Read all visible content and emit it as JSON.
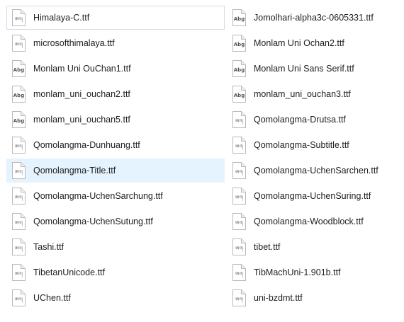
{
  "files": {
    "left": [
      {
        "name": "Himalaya-C.ttf",
        "icon": "tibetan-font-icon"
      },
      {
        "name": "microsofthimalaya.ttf",
        "icon": "tibetan-font-icon"
      },
      {
        "name": "Monlam Uni OuChan1.ttf",
        "icon": "abg-font-icon"
      },
      {
        "name": "monlam_uni_ouchan2.ttf",
        "icon": "abg-font-icon"
      },
      {
        "name": "monlam_uni_ouchan5.ttf",
        "icon": "abg-font-icon"
      },
      {
        "name": "Qomolangma-Dunhuang.ttf",
        "icon": "tibetan-font-icon"
      },
      {
        "name": "Qomolangma-Title.ttf",
        "icon": "tibetan-font-icon"
      },
      {
        "name": "Qomolangma-UchenSarchung.ttf",
        "icon": "tibetan-font-icon"
      },
      {
        "name": "Qomolangma-UchenSutung.ttf",
        "icon": "tibetan-font-icon"
      },
      {
        "name": "Tashi.ttf",
        "icon": "tibetan-font-icon"
      },
      {
        "name": "TibetanUnicode.ttf",
        "icon": "tibetan-font-icon"
      },
      {
        "name": "UChen.ttf",
        "icon": "tibetan-font-icon"
      }
    ],
    "right": [
      {
        "name": "Jomolhari-alpha3c-0605331.ttf",
        "icon": "abg-font-icon"
      },
      {
        "name": "Monlam Uni Ochan2.ttf",
        "icon": "abg-font-icon"
      },
      {
        "name": "Monlam Uni Sans Serif.ttf",
        "icon": "abg-font-icon"
      },
      {
        "name": "monlam_uni_ouchan3.ttf",
        "icon": "abg-font-icon"
      },
      {
        "name": "Qomolangma-Drutsa.ttf",
        "icon": "tibetan-font-icon"
      },
      {
        "name": "Qomolangma-Subtitle.ttf",
        "icon": "tibetan-font-icon"
      },
      {
        "name": "Qomolangma-UchenSarchen.ttf",
        "icon": "tibetan-font-icon"
      },
      {
        "name": "Qomolangma-UchenSuring.ttf",
        "icon": "tibetan-font-icon"
      },
      {
        "name": "Qomolangma-Woodblock.ttf",
        "icon": "tibetan-font-icon"
      },
      {
        "name": "tibet.ttf",
        "icon": "tibetan-font-icon"
      },
      {
        "name": "TibMachUni-1.901b.ttf",
        "icon": "tibetan-font-icon"
      },
      {
        "name": "uni-bzdmt.ttf",
        "icon": "tibetan-font-icon"
      }
    ]
  },
  "icon_glyphs": {
    "abg-font-icon": "Abg",
    "tibetan-font-icon": "ཨའ།"
  },
  "state": {
    "focused_item": "Himalaya-C.ttf",
    "hovered_item": "Qomolangma-Title.ttf"
  },
  "colors": {
    "hover_background": "#e5f3ff",
    "focus_border": "#cfdde9"
  }
}
